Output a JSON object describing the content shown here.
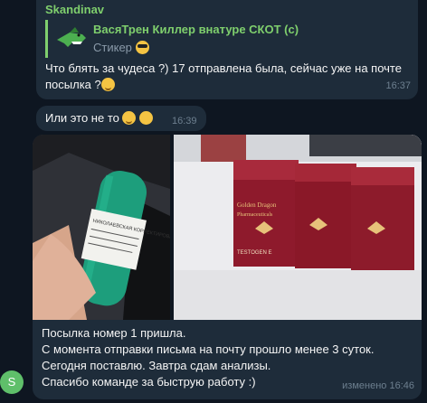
{
  "messages": {
    "m1": {
      "sender": "Skandinav",
      "reply_title": "ВасяТрен Киллер внатуре СКОТ (с)",
      "reply_subtitle": "Стикер",
      "text": "Что блять за чудеса ?) 17 отправлена была, сейчас уже на почте посылка ?",
      "time": "16:37"
    },
    "m2": {
      "text": "Или это не то",
      "time": "16:39"
    },
    "photo_a": {
      "label_text": "НИКОЛАЕВСКАЯ КОРРЕКТИРОВАНИЕ ПОСЫЛКИ"
    },
    "photo_b": {
      "brand_line1": "Golden Dragon",
      "brand_line2": "Pharmaceuticals",
      "product": "TESTOGEN E"
    },
    "m3": {
      "lines": [
        "Посылка номер 1 пришла.",
        "С момента отправки письма на почту прошло менее 3 суток.",
        "Сегодня поставлю. Завтра сдам анализы.",
        "Спасибо команде за быструю работу :)"
      ],
      "time": "изменено 16:46"
    }
  },
  "avatar": {
    "letter": "S",
    "color": "#5fbf6a"
  },
  "colors": {
    "background": "#0e1621",
    "bubble": "#1e2c3a",
    "sender": "#7fcf6d",
    "meta": "#6d7f8f"
  },
  "icons": [
    "crocodile-sticker-icon",
    "cool-face-emoji-icon",
    "grin-emoji-icon",
    "grimace-emoji-icon",
    "thinking-emoji-icon"
  ]
}
